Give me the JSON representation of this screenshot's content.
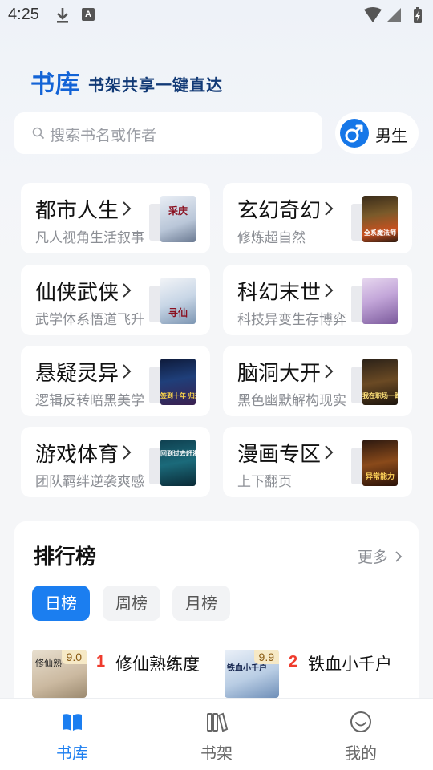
{
  "status_bar": {
    "time": "4:25"
  },
  "header": {
    "title": "书库",
    "subtitle": "书架共享一键直达"
  },
  "search": {
    "placeholder": "搜索书名或作者"
  },
  "gender_toggle": {
    "label": "男生",
    "icon": "male-icon",
    "color": "#1677e8"
  },
  "categories": [
    {
      "title": "都市人生",
      "subtitle": "凡人视角生活叙事",
      "cover_text": "采庆"
    },
    {
      "title": "玄幻奇幻",
      "subtitle": "修炼超自然",
      "cover_text": "全系魔法师"
    },
    {
      "title": "仙侠武侠",
      "subtitle": "武学体系悟道飞升",
      "cover_text": "寻仙"
    },
    {
      "title": "科幻末世",
      "subtitle": "科技异变生存博弈",
      "cover_text": ""
    },
    {
      "title": "悬疑灵异",
      "subtitle": "逻辑反转暗黑美学",
      "cover_text": "签到十年 归来"
    },
    {
      "title": "脑洞大开",
      "subtitle": "黑色幽默解构现实",
      "cover_text": "我在职场一路开挂"
    },
    {
      "title": "游戏体育",
      "subtitle": "团队羁绊逆袭爽感",
      "cover_text": "回到过去赶海生活"
    },
    {
      "title": "漫画专区",
      "subtitle": "上下翻页",
      "cover_text": "异常能力"
    }
  ],
  "ranking": {
    "title": "排行榜",
    "more": "更多",
    "tabs": [
      {
        "label": "日榜",
        "active": true
      },
      {
        "label": "周榜",
        "active": false
      },
      {
        "label": "月榜",
        "active": false
      }
    ],
    "items": [
      {
        "rank": "1",
        "name": "修仙熟练度",
        "score": "9.0",
        "cover_text": "修仙熟"
      },
      {
        "rank": "2",
        "name": "铁血小千户",
        "score": "9.9",
        "cover_text": "铁血小千户"
      }
    ]
  },
  "bottom_nav": [
    {
      "label": "书库",
      "icon": "book-open-icon",
      "active": true
    },
    {
      "label": "书架",
      "icon": "bookshelf-icon",
      "active": false
    },
    {
      "label": "我的",
      "icon": "smiley-icon",
      "active": false
    }
  ],
  "colors": {
    "accent": "#1b7ef0",
    "rank_number": "#ef3b2d",
    "title_blue": "#1363d6"
  }
}
